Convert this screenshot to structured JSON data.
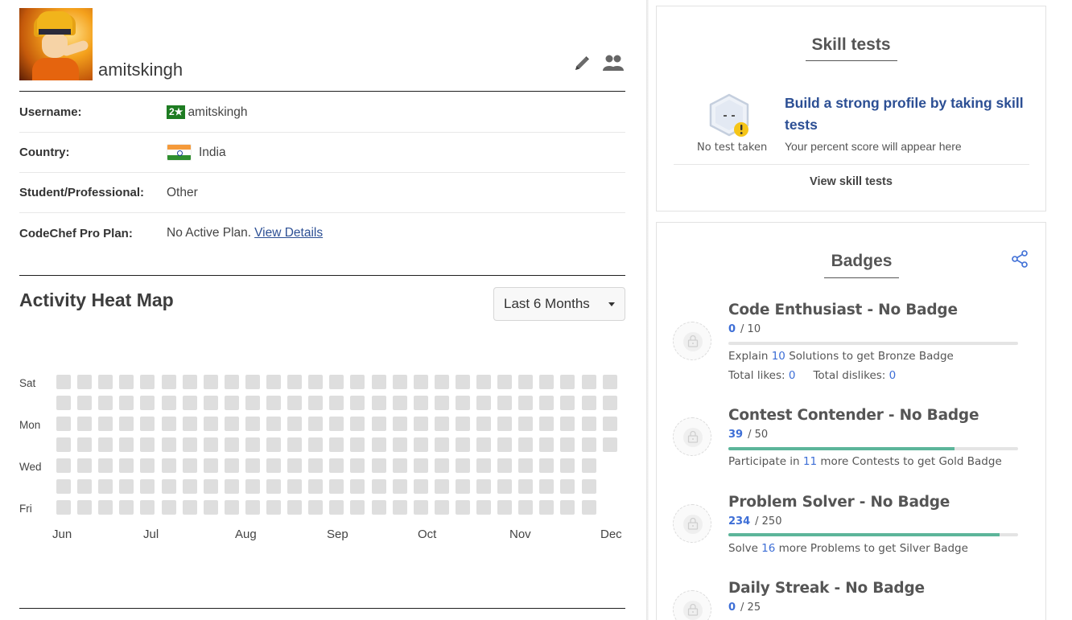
{
  "profile": {
    "display_name": "amitskingh",
    "avatar_alt": "Naruto avatar",
    "edit_icon": "pencil-icon",
    "friends_icon": "friends-icon"
  },
  "info": {
    "username_label": "Username:",
    "username_stars": "2★",
    "username_value": "amitskingh",
    "country_label": "Country:",
    "country_value": "India",
    "student_label": "Student/Professional:",
    "student_value": "Other",
    "plan_label": "CodeChef Pro Plan:",
    "plan_value": "No Active Plan.",
    "plan_link": "View Details",
    "star_color": "#1e7c22"
  },
  "heatmap": {
    "title": "Activity Heat Map",
    "range_selected": "Last 6 Months",
    "day_labels": [
      "Sat",
      "Mon",
      "Wed",
      "Fri"
    ],
    "months": [
      "Jun",
      "Jul",
      "Aug",
      "Sep",
      "Oct",
      "Nov",
      "Dec"
    ],
    "cell_color": "#dedede"
  },
  "skill_tests": {
    "title": "Skill tests",
    "status": "No test taken",
    "headline": "Build a strong profile by taking skill tests",
    "subtext": "Your percent score will appear here",
    "link": "View skill tests"
  },
  "badges": {
    "title": "Badges",
    "share_icon": "share-icon",
    "items": [
      {
        "name": "Code Enthusiast - No Badge",
        "current": "0",
        "total": "/ 10",
        "progress": 0,
        "desc_pre": "Explain ",
        "desc_num": "10",
        "desc_post": " Solutions to get Bronze Badge",
        "likes_label": "Total likes: ",
        "likes": "0",
        "dislikes_label": "Total dislikes: ",
        "dislikes": "0"
      },
      {
        "name": "Contest Contender - No Badge",
        "current": "39",
        "total": "/ 50",
        "progress": 0.78,
        "desc_pre": "Participate in ",
        "desc_num": "11",
        "desc_post": " more Contests to get Gold Badge"
      },
      {
        "name": "Problem Solver - No Badge",
        "current": "234",
        "total": "/ 250",
        "progress": 0.936,
        "desc_pre": "Solve ",
        "desc_num": "16",
        "desc_post": " more Problems to get Silver Badge"
      },
      {
        "name": "Daily Streak - No Badge",
        "current": "0",
        "total": "/ 25",
        "progress": 0
      }
    ],
    "progress_color": "#5cb59a"
  }
}
